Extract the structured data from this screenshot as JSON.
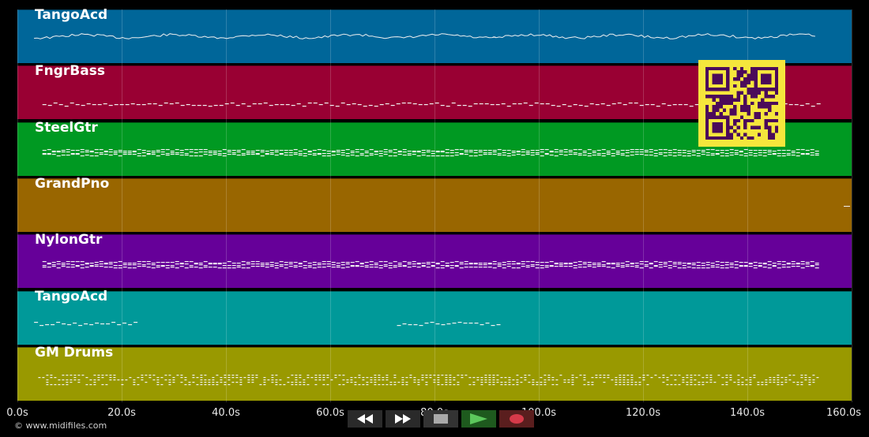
{
  "tracks": [
    {
      "name": "TangoAcd",
      "color": "#006699",
      "pattern": "wavy",
      "segments": [
        [
          0.02,
          0.575
        ],
        [
          0.57,
          0.96
        ]
      ]
    },
    {
      "name": "FngrBass",
      "color": "#990033",
      "pattern": "dash",
      "segments": [
        [
          0.03,
          0.96
        ]
      ]
    },
    {
      "name": "SteelGtr",
      "color": "#009922",
      "pattern": "dense",
      "segments": [
        [
          0.03,
          0.96
        ]
      ]
    },
    {
      "name": "GrandPno",
      "color": "#996600",
      "pattern": "none",
      "segments": []
    },
    {
      "name": "NylonGtr",
      "color": "#660099",
      "pattern": "dense",
      "segments": [
        [
          0.03,
          0.96
        ]
      ]
    },
    {
      "name": "TangoAcd",
      "color": "#009999",
      "pattern": "dash",
      "segments": [
        [
          0.02,
          0.145
        ],
        [
          0.455,
          0.578
        ]
      ]
    },
    {
      "name": "GM Drums",
      "color": "#999900",
      "pattern": "drums",
      "segments": [
        [
          0.025,
          0.96
        ]
      ]
    }
  ],
  "timeline": {
    "ticks": [
      "0.0s",
      "20.0s",
      "40.0s",
      "60.0s",
      "80.0s",
      "100.0s",
      "120.0s",
      "140.0s",
      "160.0s"
    ]
  },
  "copyright": "© www.midifiles.com",
  "transport": {
    "buttons": [
      {
        "name": "rewind-button",
        "icon": "rewind-icon"
      },
      {
        "name": "fast-forward-button",
        "icon": "fast-forward-icon"
      },
      {
        "name": "stop-button",
        "icon": "stop-icon"
      },
      {
        "name": "play-button",
        "icon": "play-icon"
      },
      {
        "name": "record-button",
        "icon": "record-icon"
      }
    ]
  },
  "qr": {
    "fg": "#4b0a5a",
    "bg": "#f5e63c"
  }
}
